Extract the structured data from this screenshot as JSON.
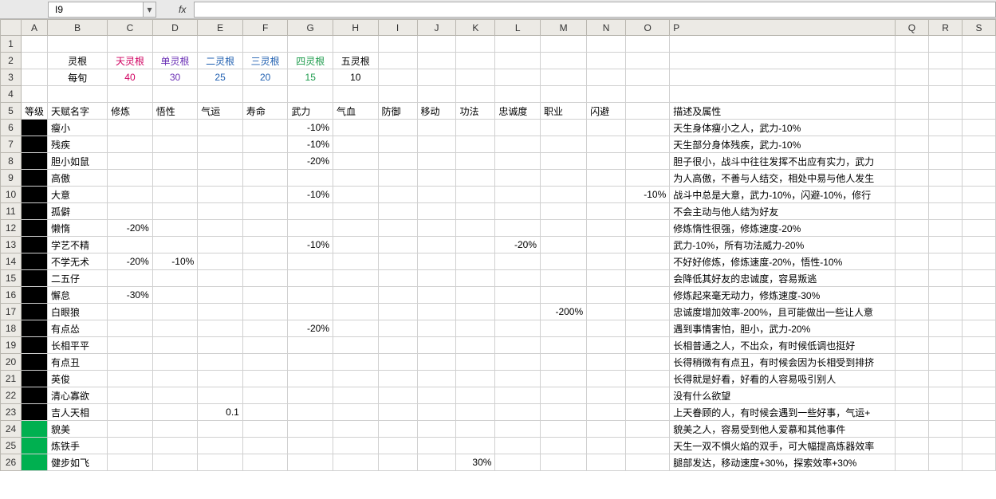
{
  "formula_bar": {
    "cell_ref": "I9",
    "fx_label": "fx",
    "dropdown_glyph": "▾",
    "formula_value": ""
  },
  "columns": [
    "A",
    "B",
    "C",
    "D",
    "E",
    "F",
    "G",
    "H",
    "I",
    "J",
    "K",
    "L",
    "M",
    "N",
    "O",
    "P",
    "Q",
    "R",
    "S"
  ],
  "row2": {
    "B": "灵根",
    "C": "天灵根",
    "D": "单灵根",
    "E": "二灵根",
    "F": "三灵根",
    "G": "四灵根",
    "H": "五灵根"
  },
  "row3": {
    "B": "每旬",
    "C": "40",
    "D": "30",
    "E": "25",
    "F": "20",
    "G": "15",
    "H": "10"
  },
  "headers5": {
    "A": "等级",
    "B": "天赋名字",
    "C": "修炼",
    "D": "悟性",
    "E": "气运",
    "F": "寿命",
    "G": "武力",
    "H": "气血",
    "I": "防御",
    "J": "移动",
    "K": "功法",
    "L": "忠诚度",
    "M": "职业",
    "N": "闪避",
    "O": "",
    "P": "描述及属性"
  },
  "talents": [
    {
      "row": 6,
      "lvl": "black",
      "name": "瘦小",
      "G": "-10%",
      "desc": "天生身体瘦小之人，武力-10%"
    },
    {
      "row": 7,
      "lvl": "black",
      "name": "残疾",
      "G": "-10%",
      "desc": "天生部分身体残疾，武力-10%"
    },
    {
      "row": 8,
      "lvl": "black",
      "name": "胆小如鼠",
      "G": "-20%",
      "desc": "胆子很小，战斗中往往发挥不出应有实力，武力"
    },
    {
      "row": 9,
      "lvl": "black",
      "name": "高傲",
      "desc": "为人高傲，不善与人结交，相处中易与他人发生"
    },
    {
      "row": 10,
      "lvl": "black",
      "name": "大意",
      "G": "-10%",
      "O": "-10%",
      "desc": "战斗中总是大意，武力-10%，闪避-10%，修行"
    },
    {
      "row": 11,
      "lvl": "black",
      "name": "孤僻",
      "desc": "不会主动与他人结为好友"
    },
    {
      "row": 12,
      "lvl": "black",
      "name": "懒惰",
      "C": "-20%",
      "desc": "修炼惰性很强，修炼速度-20%"
    },
    {
      "row": 13,
      "lvl": "black",
      "name": "学艺不精",
      "G": "-10%",
      "L": "-20%",
      "desc": "武力-10%，所有功法威力-20%"
    },
    {
      "row": 14,
      "lvl": "black",
      "name": "不学无术",
      "C": "-20%",
      "D": "-10%",
      "desc": "不好好修炼，修炼速度-20%，悟性-10%"
    },
    {
      "row": 15,
      "lvl": "black",
      "name": "二五仔",
      "desc": "会降低其好友的忠诚度，容易叛逃"
    },
    {
      "row": 16,
      "lvl": "black",
      "name": "懈怠",
      "C": "-30%",
      "desc": "修炼起来毫无动力，修炼速度-30%"
    },
    {
      "row": 17,
      "lvl": "black",
      "name": "白眼狼",
      "M": "-200%",
      "desc": "忠诚度增加效率-200%，且可能做出一些让人意"
    },
    {
      "row": 18,
      "lvl": "black",
      "name": "有点怂",
      "G": "-20%",
      "desc": "遇到事情害怕，胆小，武力-20%"
    },
    {
      "row": 19,
      "lvl": "black",
      "name": "长相平平",
      "desc": "长相普通之人，不出众，有时候低调也挺好"
    },
    {
      "row": 20,
      "lvl": "black",
      "name": "有点丑",
      "desc": "长得稍微有有点丑，有时候会因为长相受到排挤"
    },
    {
      "row": 21,
      "lvl": "black",
      "name": "英俊",
      "desc": "长得就是好看，好看的人容易吸引别人"
    },
    {
      "row": 22,
      "lvl": "black",
      "name": "清心寡欲",
      "desc": "没有什么欲望"
    },
    {
      "row": 23,
      "lvl": "black",
      "name": "吉人天相",
      "E": "0.1",
      "desc": "上天眷顾的人，有时候会遇到一些好事，气运+"
    },
    {
      "row": 24,
      "lvl": "green",
      "name": "貌美",
      "desc": "貌美之人，容易受到他人爱慕和其他事件"
    },
    {
      "row": 25,
      "lvl": "green",
      "name": "炼铁手",
      "desc": "天生一双不惧火焰的双手，可大幅提高炼器效率"
    },
    {
      "row": 26,
      "lvl": "green",
      "name": "健步如飞",
      "K": "30%",
      "desc": "腿部发达，移动速度+30%，探索效率+30%"
    }
  ],
  "row_numbers": [
    1,
    2,
    3,
    4,
    5,
    6,
    7,
    8,
    9,
    10,
    11,
    12,
    13,
    14,
    15,
    16,
    17,
    18,
    19,
    20,
    21,
    22,
    23,
    24,
    25,
    26
  ],
  "watermark": ""
}
